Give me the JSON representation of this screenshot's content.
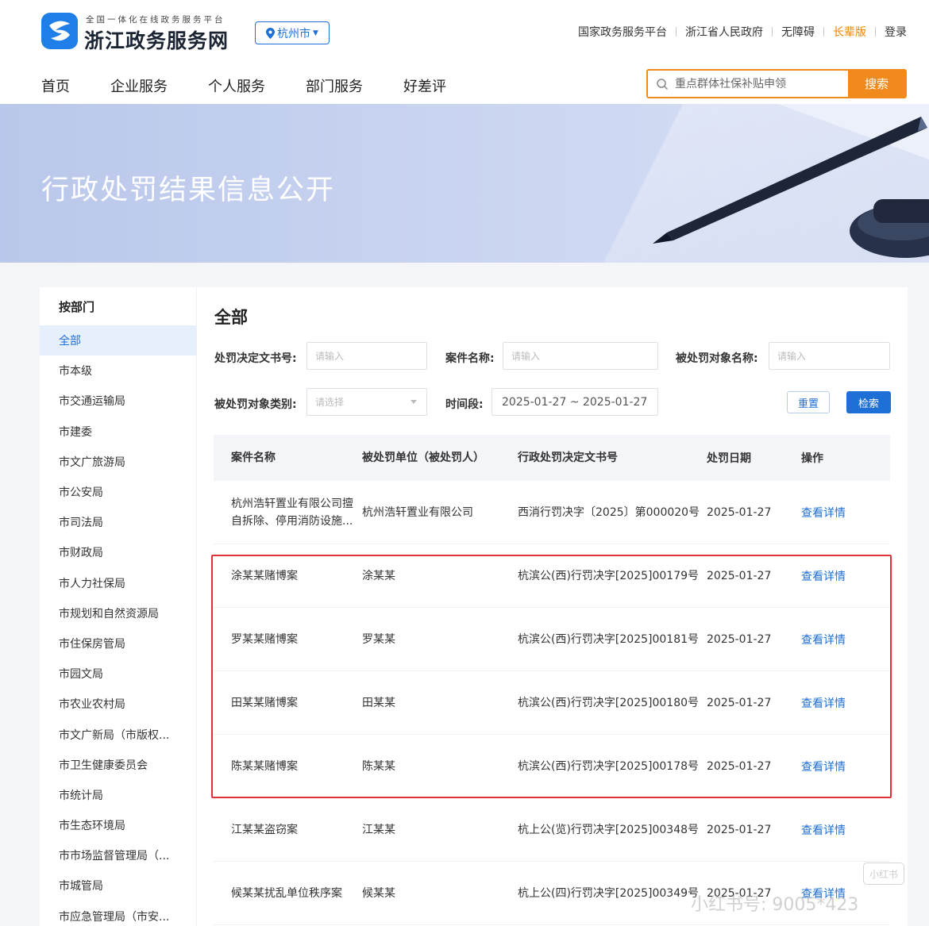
{
  "header": {
    "logo_subtitle": "全国一体化在线政务服务平台",
    "logo_title": "浙江政务服务网",
    "city_selector": "杭州市",
    "top_links": [
      "国家政务服务平台",
      "浙江省人民政府",
      "无障碍",
      "长辈版",
      "登录"
    ],
    "nav": [
      "首页",
      "企业服务",
      "个人服务",
      "部门服务",
      "好差评"
    ],
    "search": {
      "placeholder": "重点群体社保补贴申领",
      "button": "搜索"
    }
  },
  "banner": {
    "title": "行政处罚结果信息公开"
  },
  "sidebar": {
    "heading": "按部门",
    "items": [
      "全部",
      "市本级",
      "市交通运输局",
      "市建委",
      "市文广旅游局",
      "市公安局",
      "市司法局",
      "市财政局",
      "市人力社保局",
      "市规划和自然资源局",
      "市住保房管局",
      "市园文局",
      "市农业农村局",
      "市文广新局（市版权...",
      "市卫生健康委员会",
      "市统计局",
      "市生态环境局",
      "市市场监督管理局（...",
      "市城管局",
      "市应急管理局（市安..."
    ],
    "active_index": 0
  },
  "main": {
    "title": "全部",
    "filters": {
      "doc_no_label": "处罚决定文书号:",
      "doc_no_placeholder": "请输入",
      "case_name_label": "案件名称:",
      "case_name_placeholder": "请输入",
      "target_name_label": "被处罚对象名称:",
      "target_name_placeholder": "请输入",
      "target_type_label": "被处罚对象类别:",
      "target_type_placeholder": "请选择",
      "period_label": "时间段:",
      "period_value": "2025-01-27 ~ 2025-01-27",
      "reset_button": "重置",
      "search_button": "检索"
    },
    "table": {
      "headers": [
        "案件名称",
        "被处罚单位（被处罚人）",
        "行政处罚决定文书号",
        "处罚日期",
        "操作"
      ],
      "rows": [
        {
          "case": "杭州浩轩置业有限公司擅自拆除、停用消防设施...",
          "party": "杭州浩轩置业有限公司",
          "doc": "西消行罚决字〔2025〕第000020号",
          "date": "2025-01-27",
          "action": "查看详情"
        },
        {
          "case": "涂某某赌博案",
          "party": "涂某某",
          "doc": "杭滨公(西)行罚决字[2025]00179号",
          "date": "2025-01-27",
          "action": "查看详情"
        },
        {
          "case": "罗某某赌博案",
          "party": "罗某某",
          "doc": "杭滨公(西)行罚决字[2025]00181号",
          "date": "2025-01-27",
          "action": "查看详情"
        },
        {
          "case": "田某某赌博案",
          "party": "田某某",
          "doc": "杭滨公(西)行罚决字[2025]00180号",
          "date": "2025-01-27",
          "action": "查看详情"
        },
        {
          "case": "陈某某赌博案",
          "party": "陈某某",
          "doc": "杭滨公(西)行罚决字[2025]00178号",
          "date": "2025-01-27",
          "action": "查看详情"
        },
        {
          "case": "江某某盗窃案",
          "party": "江某某",
          "doc": "杭上公(览)行罚决字[2025]00348号",
          "date": "2025-01-27",
          "action": "查看详情"
        },
        {
          "case": "候某某扰乱单位秩序案",
          "party": "候某某",
          "doc": "杭上公(四)行罚决字[2025]00349号",
          "date": "2025-01-27",
          "action": "查看详情"
        }
      ]
    }
  },
  "watermark": {
    "text": "小红书号: 9005*423",
    "logo": "小红书"
  },
  "colors": {
    "primary_blue": "#1e6fd6",
    "accent_orange": "#f08a1c",
    "highlight_red": "#e0303a"
  }
}
